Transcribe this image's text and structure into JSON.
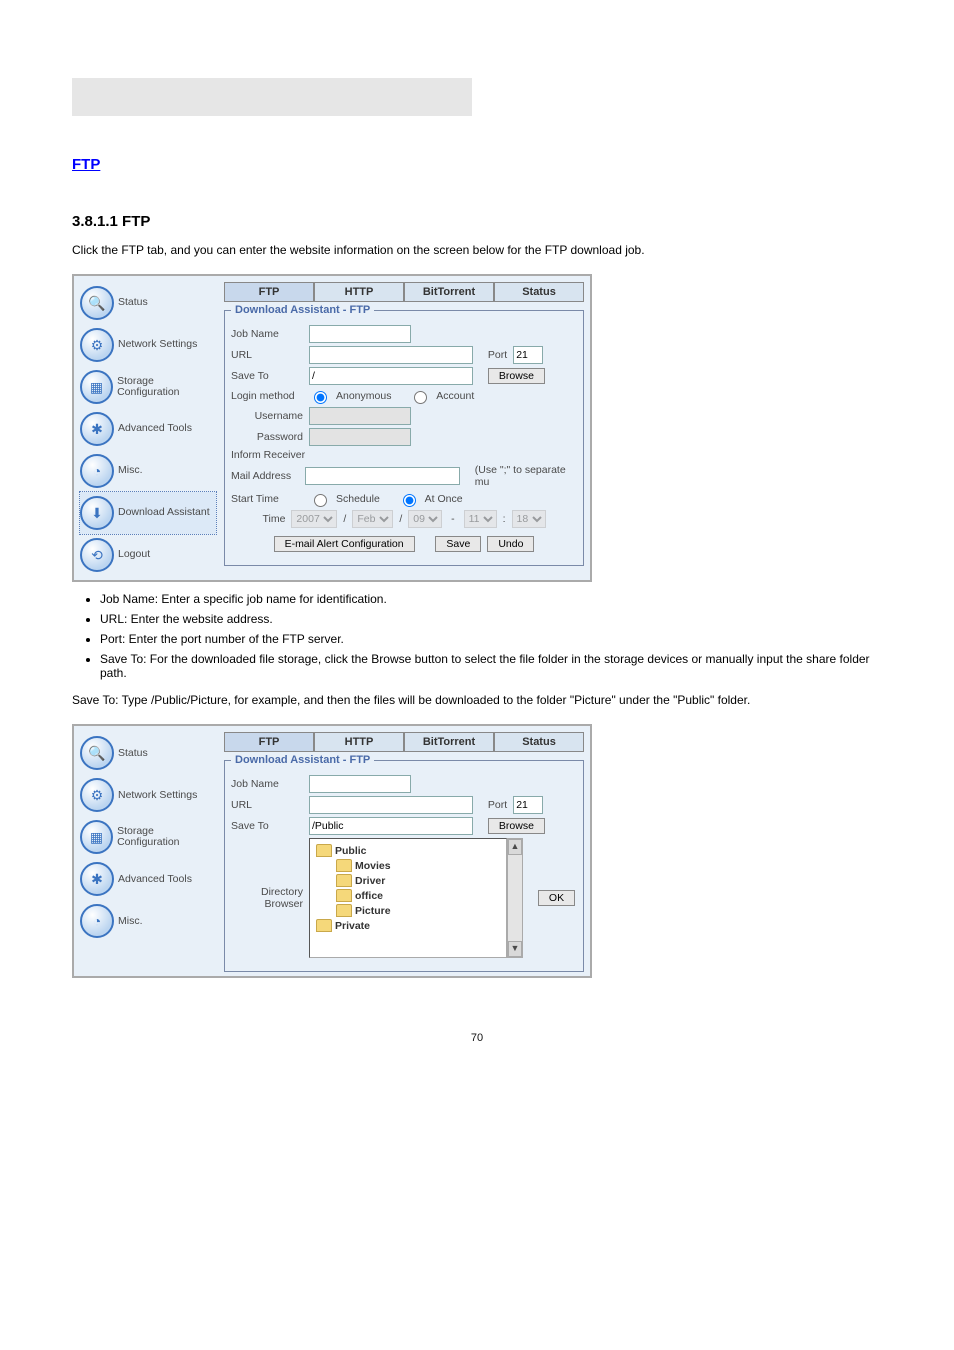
{
  "nav": {
    "items": [
      {
        "label": "Status",
        "icon": "◌"
      },
      {
        "label": "Network Settings",
        "icon": "⚙"
      },
      {
        "label": "Storage Configuration",
        "icon": "▦"
      },
      {
        "label": "Advanced Tools",
        "icon": "✱"
      },
      {
        "label": "Misc.",
        "icon": "◔"
      },
      {
        "label": "Download Assistant",
        "icon": "⬇"
      },
      {
        "label": "Logout",
        "icon": "⟲"
      }
    ]
  },
  "tabs": {
    "ftp": "FTP",
    "http": "HTTP",
    "bt": "BitTorrent",
    "status": "Status"
  },
  "panel_title": "Download Assistant - FTP",
  "labels": {
    "job": "Job Name",
    "url": "URL",
    "port": "Port",
    "saveto": "Save To",
    "browse": "Browse",
    "login": "Login method",
    "anon": "Anonymous",
    "acct": "Account",
    "user": "Username",
    "pass": "Password",
    "inform": "Inform Receiver",
    "mail": "Mail Address",
    "mailhint": "(Use \";\" to separate mu",
    "start": "Start Time",
    "sched": "Schedule",
    "once": "At Once",
    "time": "Time",
    "emailcfg": "E-mail Alert Configuration",
    "save": "Save",
    "undo": "Undo",
    "dirbrowser": "Directory Browser",
    "ok": "OK"
  },
  "values": {
    "port": "21",
    "saveto_default": "/",
    "saveto_public": "/Public",
    "year": "2007",
    "month": "Feb",
    "day": "09",
    "hh": "11",
    "mm": "18"
  },
  "folders": {
    "public": "Public",
    "movies": "Movies",
    "driver": "Driver",
    "office": "office",
    "picture": "Picture",
    "private": "Private"
  },
  "doc": {
    "heading": "3.8.1.1 FTP",
    "intro": "Click the FTP tab, and you can enter the website information on the screen below for the FTP download job.",
    "ftp_link": "FTP",
    "bullets": [
      "Job Name: Enter a specific job name for identification.",
      "URL: Enter the website address.",
      "Port: Enter the port number of the FTP server.",
      "Save To: For the downloaded file storage, click the Browse button to select the file folder in the storage devices or manually input the share folder path."
    ],
    "saveto_ex_lead": "Save To: Type /Public/Picture, for example, and then the files will be downloaded to the folder \"Picture\" under the \"Public\" folder.",
    "page": "70"
  }
}
